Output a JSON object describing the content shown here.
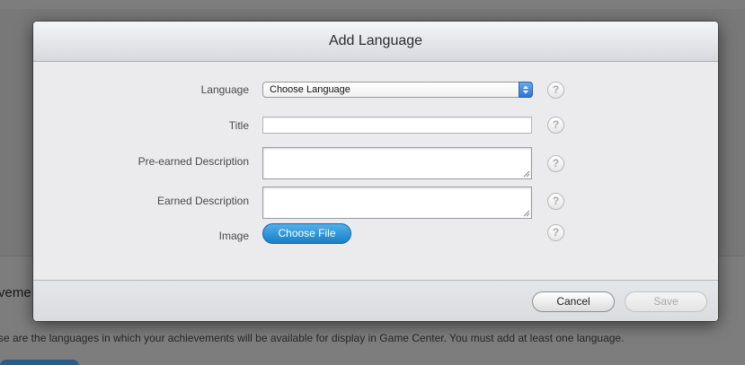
{
  "background": {
    "heading_fragment": "veme",
    "description_fragment": "se are the languages in which your achievements will be available for display in Game Center. You must add at least one language."
  },
  "modal": {
    "title": "Add Language",
    "fields": {
      "language": {
        "label": "Language",
        "selected": "Choose Language"
      },
      "title": {
        "label": "Title",
        "value": ""
      },
      "pre_earned_description": {
        "label": "Pre-earned Description",
        "value": ""
      },
      "earned_description": {
        "label": "Earned Description",
        "value": ""
      },
      "image": {
        "label": "Image",
        "button_label": "Choose File"
      }
    },
    "help_glyph": "?",
    "footer": {
      "cancel_label": "Cancel",
      "save_label": "Save"
    }
  },
  "colors": {
    "accent_blue": "#1a7fc9",
    "select_arrow_blue": "#2f76d2",
    "overlay": "#7d7d7d",
    "modal_bg": "#ebebed"
  },
  "icons": [
    "chevron-updown-icon",
    "help-icon",
    "resize-grip-icon"
  ]
}
